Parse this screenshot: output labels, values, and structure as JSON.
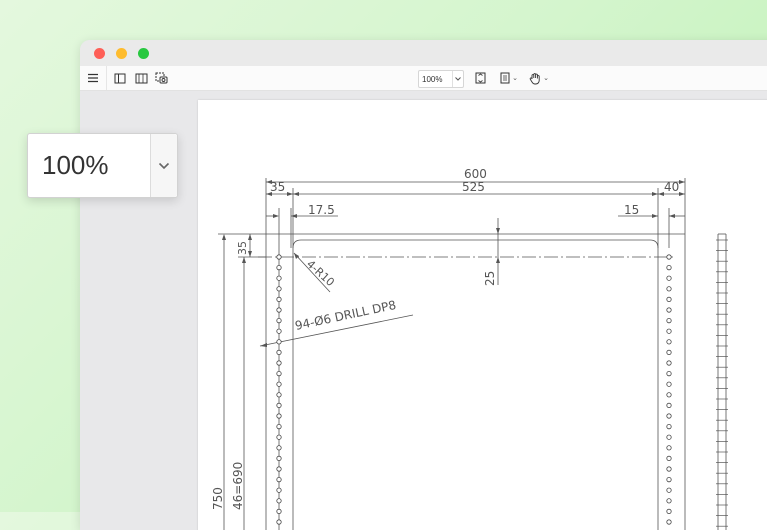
{
  "toolbar": {
    "zoom_value": "100%"
  },
  "zoom_callout": {
    "value": "100%"
  },
  "drawing": {
    "dims": {
      "total_width": "600",
      "inner_width": "525",
      "left_margin": "35",
      "right_margin": "40",
      "left_offset": "17.5",
      "right_offset": "15",
      "top_margin": "35",
      "rail_offset": "25",
      "corner_radius": "4-R10",
      "drill_note": "94-Ø6 DRILL DP8",
      "height_total": "750",
      "hole_pitch": "46=690"
    }
  }
}
